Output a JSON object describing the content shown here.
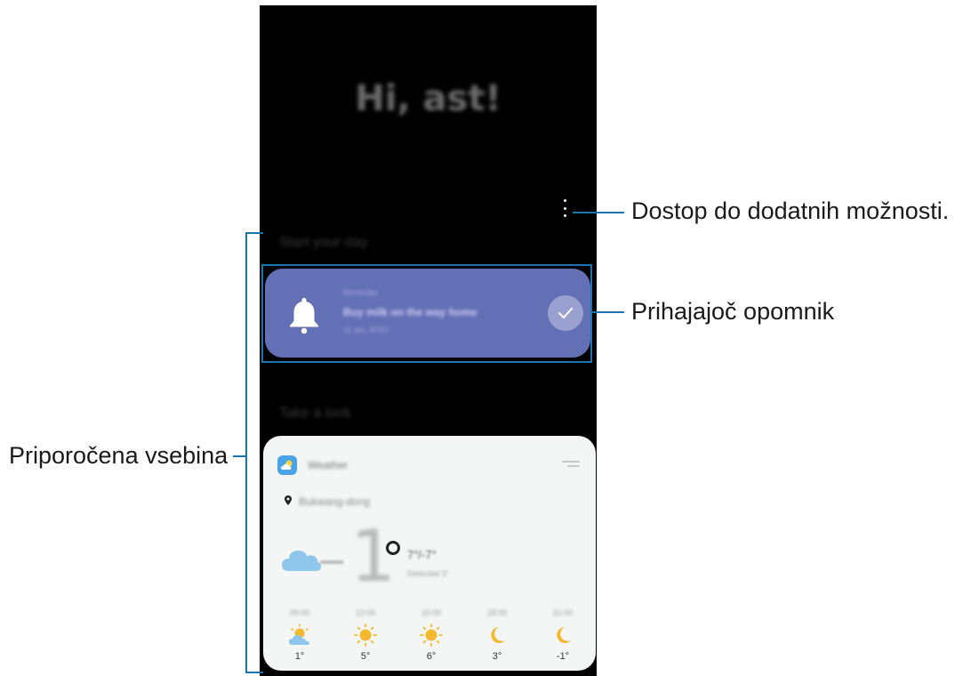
{
  "phone": {
    "greeting": "Hi, ast!",
    "section_start": "Start your day",
    "section_look": "Take a look"
  },
  "reminder": {
    "category": "Reminder",
    "title": "Buy milk on the way home",
    "time": "11 am, 07/07",
    "icon": "bell-icon",
    "accent": "#6470b6"
  },
  "weather": {
    "app_name": "Weather",
    "location": "Bukwang-dong",
    "current_temp": "1",
    "high_low": "7°/-7°",
    "feels_like": "Detected 3°",
    "forecast": [
      {
        "time": "09:00",
        "icon": "partly-cloudy-icon",
        "temp": "1°"
      },
      {
        "time": "12:00",
        "icon": "sun-icon",
        "temp": "5°"
      },
      {
        "time": "15:00",
        "icon": "sun-icon",
        "temp": "6°"
      },
      {
        "time": "18:00",
        "icon": "moon-icon",
        "temp": "3°"
      },
      {
        "time": "21:00",
        "icon": "moon-icon",
        "temp": "-1°"
      }
    ]
  },
  "callouts": {
    "more_options": "Dostop do dodatnih možnosti.",
    "upcoming_reminder": "Prihajajoč opomnik",
    "recommended": "Priporočena vsebina"
  },
  "colors": {
    "callout_line": "#1b74ad",
    "screen_bg": "#000000",
    "card_bg": "#f4f6f6"
  }
}
